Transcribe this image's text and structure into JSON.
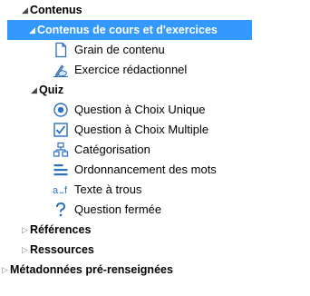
{
  "tree": {
    "contenus": {
      "label": "Contenus"
    },
    "cours": {
      "label": "Contenus de cours et d'exercices"
    },
    "grain": {
      "label": "Grain de contenu",
      "icon": "page-icon"
    },
    "exercice": {
      "label": "Exercice rédactionnel",
      "icon": "writing-hand-icon"
    },
    "quiz": {
      "label": "Quiz"
    },
    "qcu": {
      "label": "Question à Choix Unique",
      "icon": "radio-icon"
    },
    "qcm": {
      "label": "Question à Choix Multiple",
      "icon": "checkbox-icon"
    },
    "categorisation": {
      "label": "Catégorisation",
      "icon": "hierarchy-icon"
    },
    "ordonnancement": {
      "label": "Ordonnancement des mots",
      "icon": "lines-icon"
    },
    "texte_trous": {
      "label": "Texte à trous",
      "icon": "fill-blank-icon"
    },
    "question_fermee": {
      "label": "Question fermée",
      "icon": "question-mark-icon"
    },
    "references": {
      "label": "Références"
    },
    "ressources": {
      "label": "Ressources"
    },
    "metadonnees": {
      "label": "Métadonnées pré-renseignées"
    }
  },
  "colors": {
    "selection": "#3399ff",
    "icon_blue": "#2a6fc2"
  }
}
